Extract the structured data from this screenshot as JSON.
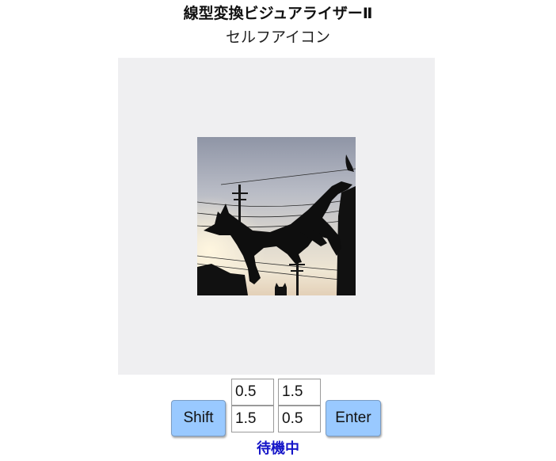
{
  "header": {
    "title": "線型変換ビジュアライザーⅡ",
    "subtitle": "セルフアイコン"
  },
  "matrix": {
    "a11": "0.5",
    "a12": "1.5",
    "a21": "1.5",
    "a22": "0.5"
  },
  "controls": {
    "shift_label": "Shift",
    "enter_label": "Enter"
  },
  "status": {
    "text": "待機中",
    "color": "#1515c8"
  },
  "colors": {
    "canvas_bg": "#efeff1",
    "button_bg": "#99c9ff"
  }
}
